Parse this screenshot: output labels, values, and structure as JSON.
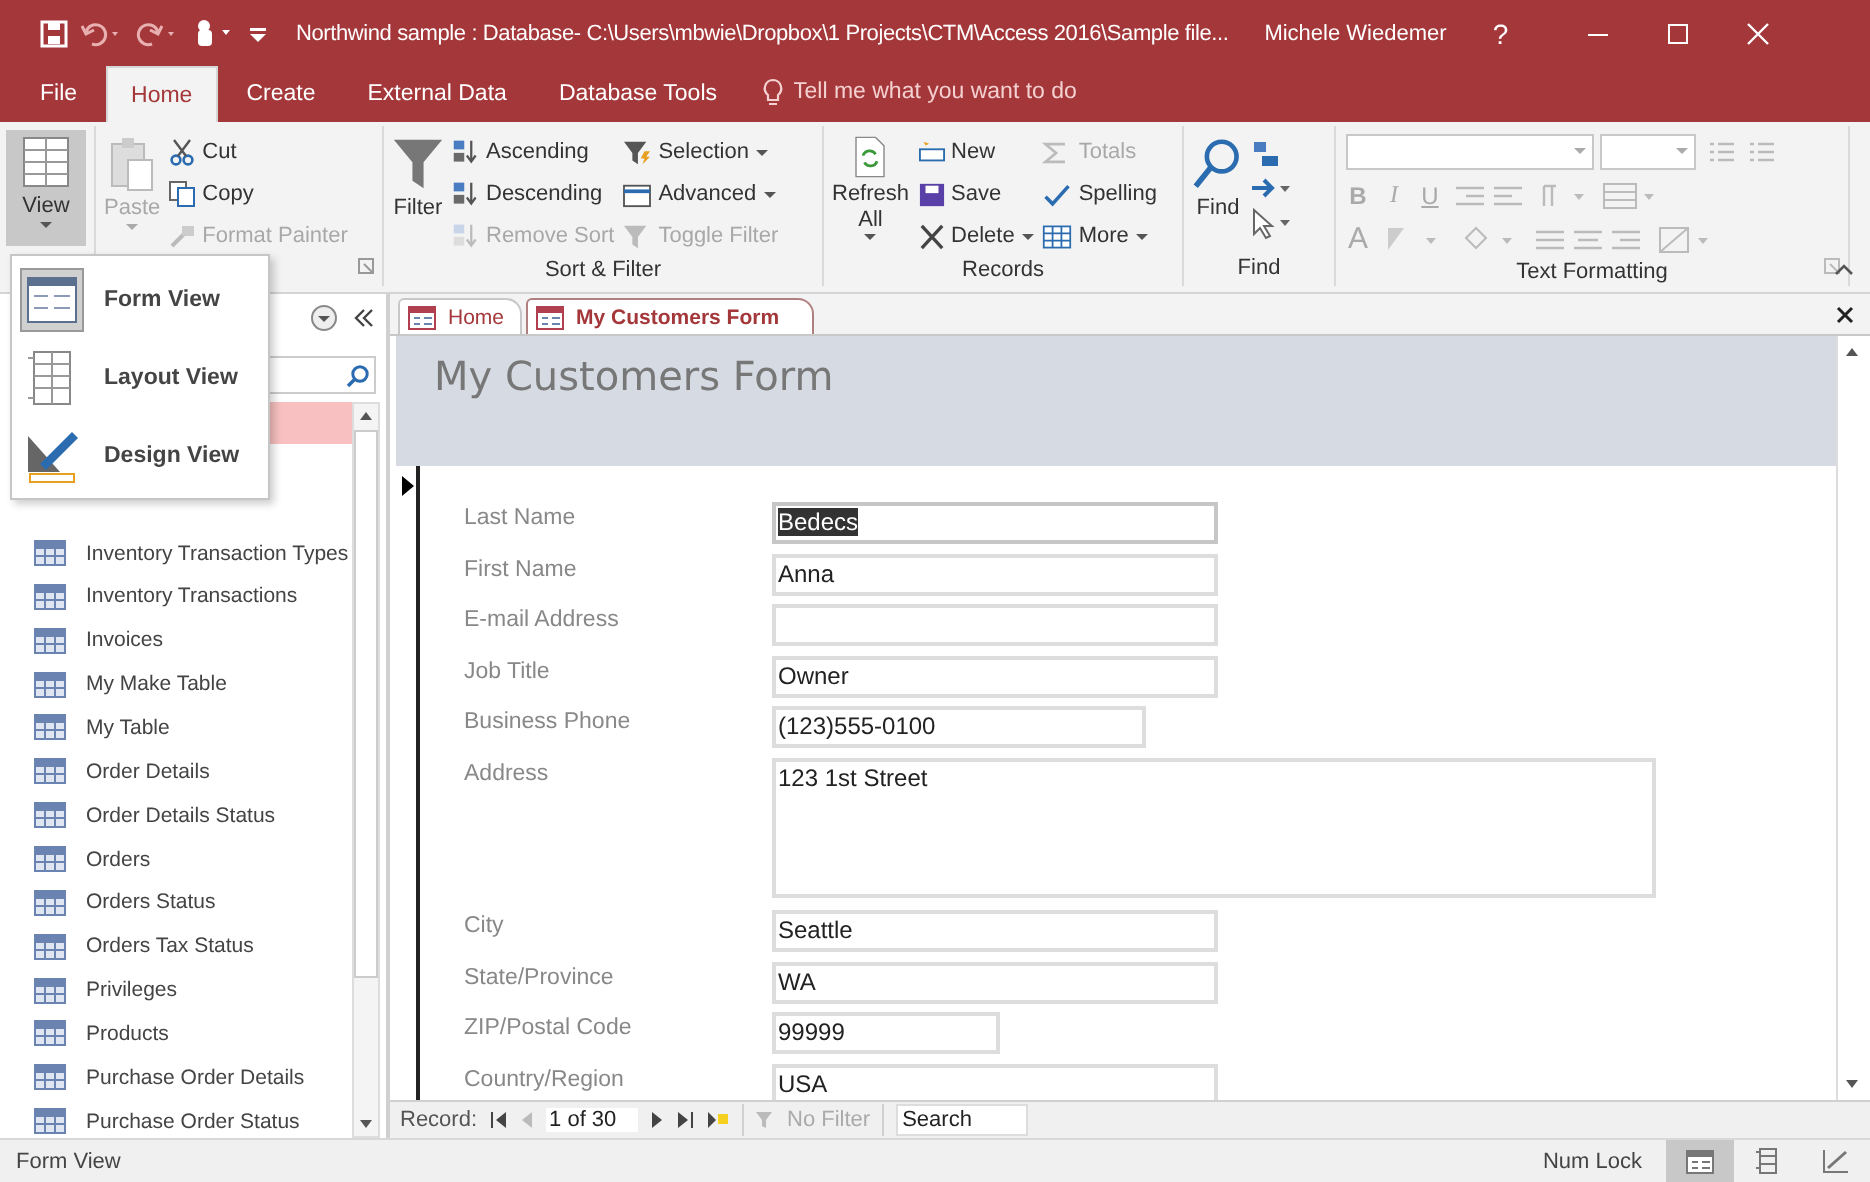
{
  "title_bar": {
    "title": "Northwind sample : Database- C:\\Users\\mbwie\\Dropbox\\1 Projects\\CTM\\Access 2016\\Sample file...",
    "user": "Michele Wiedemer",
    "help": "?"
  },
  "ribbon_tabs": [
    {
      "label": "File",
      "selected": false
    },
    {
      "label": "Home",
      "selected": true
    },
    {
      "label": "Create",
      "selected": false
    },
    {
      "label": "External Data",
      "selected": false
    },
    {
      "label": "Database Tools",
      "selected": false
    }
  ],
  "tell_me": {
    "placeholder": "Tell me what you want to do"
  },
  "views": {
    "label": "View"
  },
  "clipboard": {
    "commands": [
      {
        "label": "Paste",
        "disabled": true
      },
      {
        "label": "Cut",
        "disabled": false
      },
      {
        "label": "Copy",
        "disabled": false
      },
      {
        "label": "Format Painter",
        "disabled": true
      }
    ]
  },
  "sort_filter": {
    "label": "Sort & Filter",
    "commands": [
      {
        "label": "Filter",
        "disabled": false
      },
      {
        "label": "Ascending",
        "disabled": false
      },
      {
        "label": "Descending",
        "disabled": false
      },
      {
        "label": "Remove Sort",
        "disabled": true
      },
      {
        "label": "Selection",
        "disabled": false
      },
      {
        "label": "Advanced",
        "disabled": false
      },
      {
        "label": "Toggle Filter",
        "disabled": true
      }
    ]
  },
  "records": {
    "label": "Records",
    "refresh": [
      "Refresh",
      "All"
    ],
    "commands": [
      {
        "label": "New",
        "disabled": false
      },
      {
        "label": "Save",
        "disabled": false
      },
      {
        "label": "Delete",
        "disabled": false
      },
      {
        "label": "Totals",
        "disabled": true
      },
      {
        "label": "Spelling",
        "disabled": false
      },
      {
        "label": "More",
        "disabled": false
      }
    ]
  },
  "find": {
    "label": "Find",
    "button": "Find"
  },
  "text_formatting": {
    "label": "Text Formatting",
    "letters": [
      "B",
      "I",
      "U",
      "A"
    ]
  },
  "view_menu": [
    {
      "label": "Form View",
      "kind": "form",
      "selected": true
    },
    {
      "label": "Layout View",
      "kind": "layout",
      "selected": false
    },
    {
      "label": "Design View",
      "kind": "design",
      "selected": false
    }
  ],
  "nav_items": [
    "Inventory Transaction Types",
    "Inventory Transactions",
    "Invoices",
    "My Make Table",
    "My Table",
    "Order Details",
    "Order Details Status",
    "Orders",
    "Orders Status",
    "Orders Tax Status",
    "Privileges",
    "Products",
    "Purchase Order Details",
    "Purchase Order Status"
  ],
  "doc_tabs": [
    {
      "label": "Home",
      "selected": false
    },
    {
      "label": "My Customers Form",
      "selected": true
    }
  ],
  "form": {
    "title": "My Customers Form",
    "fields": [
      {
        "label": "Last Name",
        "value": "Bedecs",
        "kind": "wide",
        "selected": true
      },
      {
        "label": "First Name",
        "value": "Anna",
        "kind": "wide",
        "selected": false
      },
      {
        "label": "E-mail Address",
        "kind": "wide",
        "selected": false
      },
      {
        "label": "Job Title",
        "value": "Owner",
        "kind": "wide",
        "selected": false
      },
      {
        "label": "Business Phone",
        "value": "(123)555-0100",
        "kind": "medium",
        "selected": false
      },
      {
        "label": "Address",
        "value": "123 1st Street",
        "kind": "multiline",
        "selected": false
      },
      {
        "label": "City",
        "value": "Seattle",
        "kind": "wide",
        "selected": false
      },
      {
        "label": "State/Province",
        "value": "WA",
        "kind": "wide",
        "selected": false
      },
      {
        "label": "ZIP/Postal Code",
        "value": "99999",
        "kind": "narrow",
        "selected": false
      },
      {
        "label": "Country/Region",
        "value": "USA",
        "kind": "wide",
        "selected": false
      }
    ]
  },
  "record_nav": {
    "label": "Record:",
    "position": "1 of 30",
    "filter": "No Filter",
    "search": {
      "placeholder": "Search"
    }
  },
  "status_bar": {
    "text": "Form View",
    "num_lock": "Num Lock",
    "views": [
      {
        "kind": "form",
        "selected": true
      },
      {
        "kind": "layout",
        "selected": false
      },
      {
        "kind": "design",
        "selected": false
      }
    ]
  }
}
